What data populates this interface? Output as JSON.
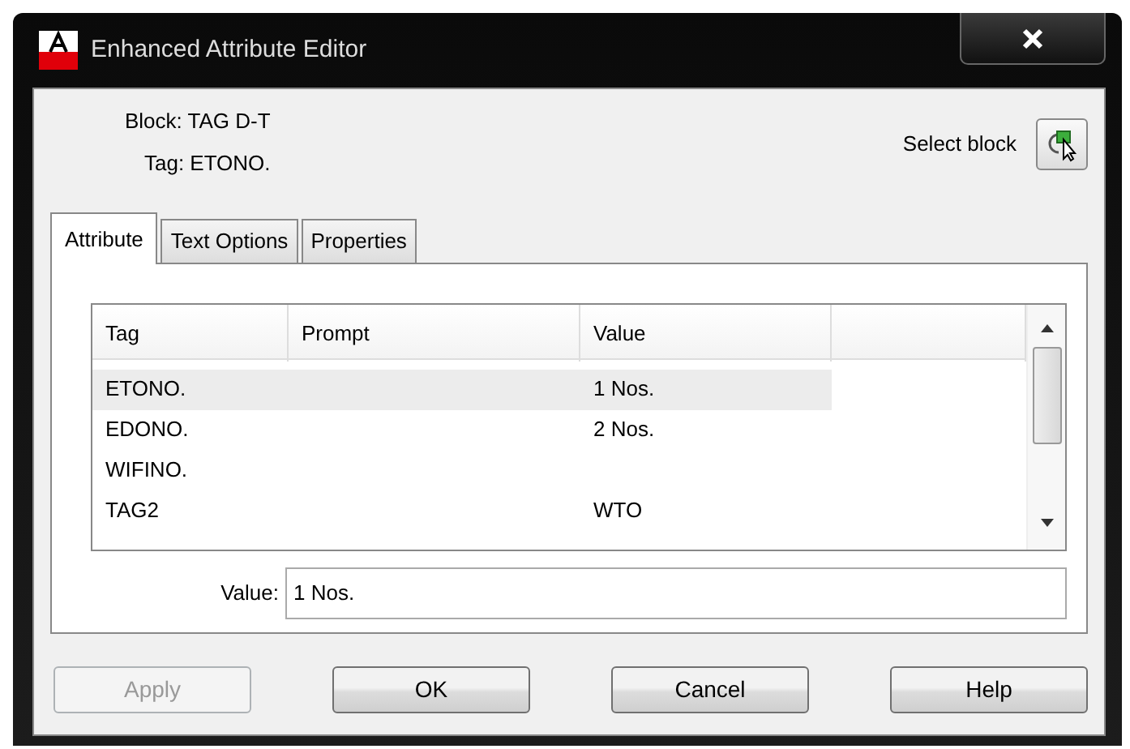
{
  "window": {
    "title": "Enhanced Attribute Editor"
  },
  "header": {
    "block": "Block: TAG D-T",
    "tag": "Tag: ETONO.",
    "select_label": "Select block"
  },
  "tabs": [
    {
      "label": "Attribute",
      "selected": true
    },
    {
      "label": "Text Options",
      "selected": false
    },
    {
      "label": "Properties",
      "selected": false
    }
  ],
  "table": {
    "columns": [
      "Tag",
      "Prompt",
      "Value"
    ],
    "rows": [
      {
        "cells": [
          "ETONO.",
          "",
          "1 Nos."
        ],
        "selected": true
      },
      {
        "cells": [
          "EDONO.",
          "",
          "2 Nos."
        ],
        "selected": false
      },
      {
        "cells": [
          "WIFINO.",
          "",
          ""
        ],
        "selected": false
      },
      {
        "cells": [
          "TAG2",
          "",
          "WTO"
        ],
        "selected": false
      }
    ]
  },
  "value_field": {
    "label": "Value:",
    "value": "1 Nos."
  },
  "buttons": [
    {
      "label": "Apply",
      "disabled": true
    },
    {
      "label": "OK",
      "disabled": false
    },
    {
      "label": "Cancel",
      "disabled": false
    },
    {
      "label": "Help",
      "disabled": false
    }
  ]
}
